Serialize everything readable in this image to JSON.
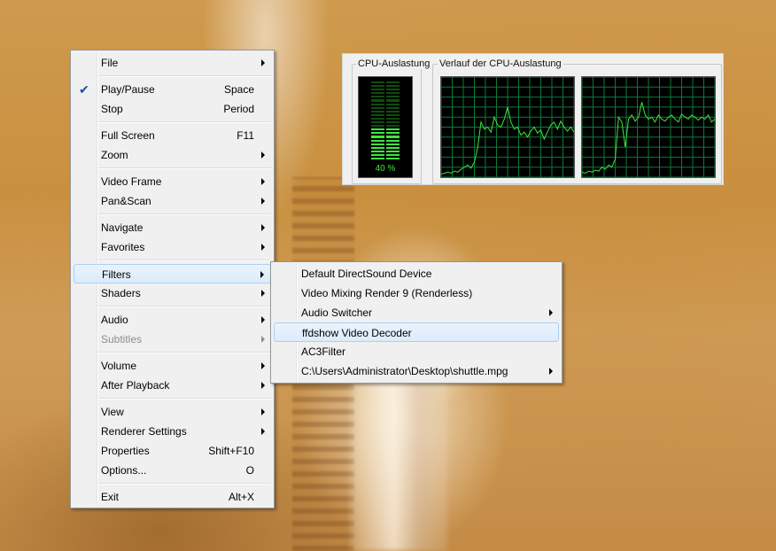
{
  "cpu": {
    "usage_label": "CPU-Auslastung",
    "history_label": "Verlauf der CPU-Auslastung",
    "usage_percent": 40,
    "usage_text": "40 %",
    "graph_color": "#3ee63e",
    "grid_color": "#0c7a3a",
    "core1": [
      0.03,
      0.04,
      0.05,
      0.04,
      0.06,
      0.05,
      0.08,
      0.1,
      0.12,
      0.09,
      0.15,
      0.3,
      0.55,
      0.48,
      0.5,
      0.45,
      0.6,
      0.52,
      0.5,
      0.58,
      0.7,
      0.55,
      0.48,
      0.5,
      0.42,
      0.45,
      0.4,
      0.46,
      0.5,
      0.44,
      0.47,
      0.38,
      0.45,
      0.52,
      0.55,
      0.48,
      0.56,
      0.5,
      0.46,
      0.5,
      0.45
    ],
    "core2": [
      0.05,
      0.04,
      0.06,
      0.05,
      0.07,
      0.06,
      0.1,
      0.08,
      0.12,
      0.1,
      0.18,
      0.6,
      0.55,
      0.3,
      0.58,
      0.62,
      0.56,
      0.6,
      0.75,
      0.62,
      0.58,
      0.6,
      0.55,
      0.62,
      0.58,
      0.56,
      0.6,
      0.62,
      0.58,
      0.55,
      0.63,
      0.6,
      0.58,
      0.62,
      0.6,
      0.57,
      0.6,
      0.58,
      0.62,
      0.55,
      0.58
    ]
  },
  "main_menu": [
    {
      "label": "File",
      "submenu": true
    },
    {
      "sep": true
    },
    {
      "label": "Play/Pause",
      "shortcut": "Space",
      "checked": true
    },
    {
      "label": "Stop",
      "shortcut": "Period"
    },
    {
      "sep": true
    },
    {
      "label": "Full Screen",
      "shortcut": "F11"
    },
    {
      "label": "Zoom",
      "submenu": true
    },
    {
      "sep": true
    },
    {
      "label": "Video Frame",
      "submenu": true
    },
    {
      "label": "Pan&Scan",
      "submenu": true
    },
    {
      "sep": true
    },
    {
      "label": "Navigate",
      "submenu": true
    },
    {
      "label": "Favorites",
      "submenu": true
    },
    {
      "sep": true
    },
    {
      "label": "Filters",
      "submenu": true,
      "highlighted": true
    },
    {
      "label": "Shaders",
      "submenu": true
    },
    {
      "sep": true
    },
    {
      "label": "Audio",
      "submenu": true
    },
    {
      "label": "Subtitles",
      "submenu": true,
      "disabled": true
    },
    {
      "sep": true
    },
    {
      "label": "Volume",
      "submenu": true
    },
    {
      "label": "After Playback",
      "submenu": true
    },
    {
      "sep": true
    },
    {
      "label": "View",
      "submenu": true
    },
    {
      "label": "Renderer Settings",
      "submenu": true
    },
    {
      "label": "Properties",
      "shortcut": "Shift+F10"
    },
    {
      "label": "Options...",
      "shortcut": "O"
    },
    {
      "sep": true
    },
    {
      "label": "Exit",
      "shortcut": "Alt+X"
    }
  ],
  "filters_menu": [
    {
      "label": "Default DirectSound Device"
    },
    {
      "label": "Video Mixing Render 9 (Renderless)"
    },
    {
      "label": "Audio Switcher",
      "submenu": true
    },
    {
      "label": "ffdshow Video Decoder",
      "highlighted": true
    },
    {
      "label": "AC3Filter"
    },
    {
      "label": "C:\\Users\\Administrator\\Desktop\\shuttle.mpg",
      "submenu": true
    }
  ]
}
